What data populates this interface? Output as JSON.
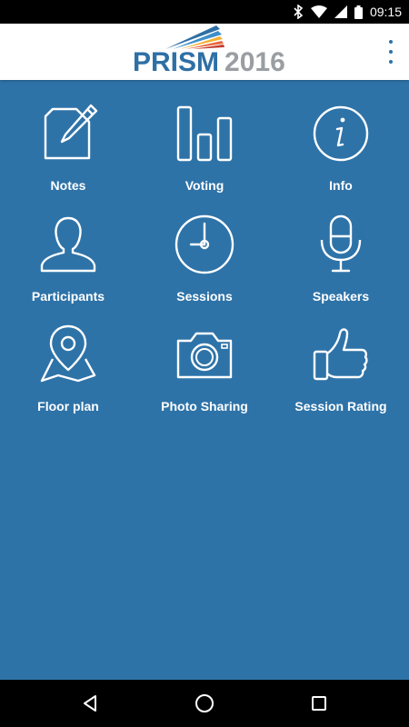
{
  "status_bar": {
    "time": "09:15",
    "icons": [
      "bluetooth-icon",
      "wifi-icon",
      "cell-signal-icon",
      "battery-icon"
    ]
  },
  "header": {
    "logo_prism": "PRISM",
    "logo_year": "2016",
    "menu_icon": "overflow-menu-icon"
  },
  "colors": {
    "background": "#2e73a8",
    "header_bg": "#ffffff",
    "logo_blue": "#2e6fa5",
    "logo_gray": "#9a9ea3",
    "icon_stroke": "#ffffff"
  },
  "menu": {
    "items": [
      {
        "label": "Notes",
        "icon": "notes-icon"
      },
      {
        "label": "Voting",
        "icon": "voting-icon"
      },
      {
        "label": "Info",
        "icon": "info-icon"
      },
      {
        "label": "Participants",
        "icon": "participants-icon"
      },
      {
        "label": "Sessions",
        "icon": "clock-icon"
      },
      {
        "label": "Speakers",
        "icon": "microphone-icon"
      },
      {
        "label": "Floor plan",
        "icon": "map-pin-icon"
      },
      {
        "label": "Photo Sharing",
        "icon": "camera-icon"
      },
      {
        "label": "Session Rating",
        "icon": "thumbs-up-icon"
      }
    ]
  },
  "nav_bar": {
    "back": "back-icon",
    "home": "home-icon",
    "recents": "recents-icon"
  }
}
